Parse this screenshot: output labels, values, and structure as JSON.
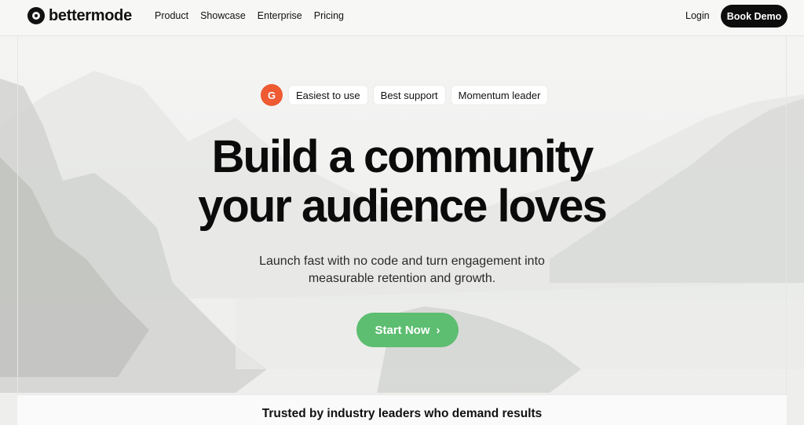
{
  "brand": {
    "name": "bettermode"
  },
  "nav": {
    "links": [
      "Product",
      "Showcase",
      "Enterprise",
      "Pricing"
    ],
    "login": "Login",
    "cta": "Book Demo"
  },
  "badges": {
    "g2_icon": "G",
    "items": [
      "Easiest to use",
      "Best support",
      "Momentum leader"
    ]
  },
  "hero": {
    "headline_line1": "Build a community",
    "headline_line2": "your audience loves",
    "subtext_line1": "Launch fast with no code and turn engagement into",
    "subtext_line2": "measurable retention and growth.",
    "cta": "Start Now",
    "cta_icon": "chevron-right-icon"
  },
  "trusted": {
    "text": "Trusted by industry leaders who demand results"
  },
  "colors": {
    "accent_green": "#5dbd70",
    "g2_orange": "#ee5a32",
    "dark": "#0d0d0d"
  }
}
